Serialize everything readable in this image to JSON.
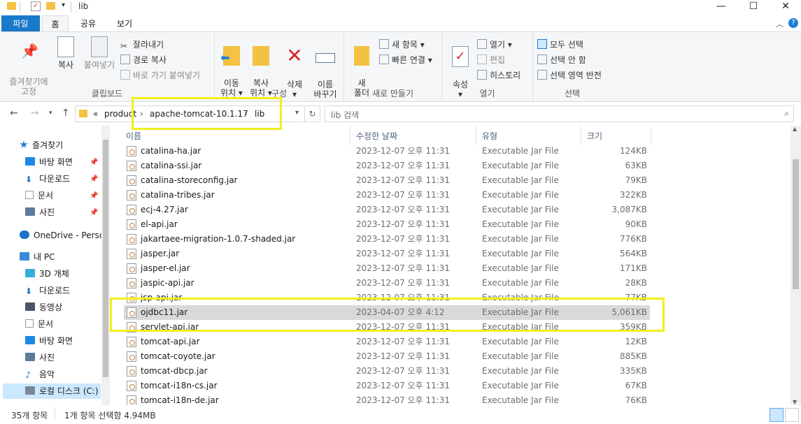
{
  "window": {
    "title": "lib",
    "minimize": "—",
    "maximize": "☐",
    "close": "✕"
  },
  "tabs": {
    "file": "파일",
    "home": "홈",
    "share": "공유",
    "view": "보기"
  },
  "ribbon": {
    "clipboard": {
      "label": "클립보드",
      "pin": "즐겨찾기에\n고정",
      "copy": "복사",
      "paste": "붙여넣기",
      "cut": "잘라내기",
      "copy_path": "경로 복사",
      "paste_shortcut": "바로 가기 붙여넣기"
    },
    "organize": {
      "label": "구성",
      "move_to": "이동\n위치 ▾",
      "copy_to": "복사\n위치 ▾",
      "delete": "삭제\n▾",
      "rename": "이름\n바꾸기"
    },
    "new": {
      "label": "새로 만들기",
      "new_folder": "새\n폴더",
      "new_item": "새 항목 ▾",
      "easy_access": "빠른 연결 ▾"
    },
    "open": {
      "label": "열기",
      "properties": "속성\n▾",
      "open": "열기 ▾",
      "edit": "편집",
      "history": "히스토리"
    },
    "select": {
      "label": "선택",
      "select_all": "모두 선택",
      "select_none": "선택 안 함",
      "invert": "선택 영역 반전"
    }
  },
  "address": {
    "overflow": "«",
    "segments": [
      "product",
      "apache-tomcat-10.1.17",
      "lib"
    ],
    "separator": "›",
    "search_placeholder": "lib 검색"
  },
  "nav": {
    "items": [
      {
        "label": "즐겨찾기",
        "icon": "star-icon",
        "color": "#1e7fd6",
        "pinned": false
      },
      {
        "label": "바탕 화면",
        "icon": "desktop-icon",
        "color": "#1e88e5",
        "pinned": true
      },
      {
        "label": "다운로드",
        "icon": "download-icon",
        "color": "#1e70c8",
        "pinned": true
      },
      {
        "label": "문서",
        "icon": "document-icon",
        "color": "#8a9bb0",
        "pinned": true
      },
      {
        "label": "사진",
        "icon": "pictures-icon",
        "color": "#5c7a9a",
        "pinned": true
      },
      {
        "label": "OneDrive - Person",
        "icon": "cloud-icon",
        "color": "#1a73c9",
        "pinned": false
      },
      {
        "label": "내 PC",
        "icon": "computer-icon",
        "color": "#3b8ad6",
        "pinned": false
      },
      {
        "label": "3D 개체",
        "icon": "cube-icon",
        "color": "#35b0d8",
        "pinned": false
      },
      {
        "label": "다운로드",
        "icon": "download-icon",
        "color": "#1e70c8",
        "pinned": false
      },
      {
        "label": "동영상",
        "icon": "video-icon",
        "color": "#4a5568",
        "pinned": false
      },
      {
        "label": "문서",
        "icon": "document-icon",
        "color": "#8a9bb0",
        "pinned": false
      },
      {
        "label": "바탕 화면",
        "icon": "desktop-icon",
        "color": "#1e88e5",
        "pinned": false
      },
      {
        "label": "사진",
        "icon": "pictures-icon",
        "color": "#5c7a9a",
        "pinned": false
      },
      {
        "label": "음악",
        "icon": "music-icon",
        "color": "#1e7fd6",
        "pinned": false
      },
      {
        "label": "로컬 디스크 (C:)",
        "icon": "drive-icon",
        "color": "#7a8794",
        "pinned": false
      }
    ]
  },
  "columns": {
    "name": "이름",
    "date": "수정한 날짜",
    "type": "유형",
    "size": "크기"
  },
  "files": [
    {
      "name": "catalina-ha.jar",
      "date": "2023-12-07 오후 11:31",
      "type": "Executable Jar File",
      "size": "124KB"
    },
    {
      "name": "catalina-ssi.jar",
      "date": "2023-12-07 오후 11:31",
      "type": "Executable Jar File",
      "size": "63KB"
    },
    {
      "name": "catalina-storeconfig.jar",
      "date": "2023-12-07 오후 11:31",
      "type": "Executable Jar File",
      "size": "79KB"
    },
    {
      "name": "catalina-tribes.jar",
      "date": "2023-12-07 오후 11:31",
      "type": "Executable Jar File",
      "size": "322KB"
    },
    {
      "name": "ecj-4.27.jar",
      "date": "2023-12-07 오후 11:31",
      "type": "Executable Jar File",
      "size": "3,087KB"
    },
    {
      "name": "el-api.jar",
      "date": "2023-12-07 오후 11:31",
      "type": "Executable Jar File",
      "size": "90KB"
    },
    {
      "name": "jakartaee-migration-1.0.7-shaded.jar",
      "date": "2023-12-07 오후 11:31",
      "type": "Executable Jar File",
      "size": "776KB"
    },
    {
      "name": "jasper.jar",
      "date": "2023-12-07 오후 11:31",
      "type": "Executable Jar File",
      "size": "564KB"
    },
    {
      "name": "jasper-el.jar",
      "date": "2023-12-07 오후 11:31",
      "type": "Executable Jar File",
      "size": "171KB"
    },
    {
      "name": "jaspic-api.jar",
      "date": "2023-12-07 오후 11:31",
      "type": "Executable Jar File",
      "size": "28KB"
    },
    {
      "name": "jsp-api.jar",
      "date": "2023-12-07 오후 11:31",
      "type": "Executable Jar File",
      "size": "77KB"
    },
    {
      "name": "ojdbc11.jar",
      "date": "2023-04-07 오후 4:12",
      "type": "Executable Jar File",
      "size": "5,061KB",
      "selected": true
    },
    {
      "name": "servlet-api.jar",
      "date": "2023-12-07 오후 11:31",
      "type": "Executable Jar File",
      "size": "359KB"
    },
    {
      "name": "tomcat-api.jar",
      "date": "2023-12-07 오후 11:31",
      "type": "Executable Jar File",
      "size": "12KB"
    },
    {
      "name": "tomcat-coyote.jar",
      "date": "2023-12-07 오후 11:31",
      "type": "Executable Jar File",
      "size": "885KB"
    },
    {
      "name": "tomcat-dbcp.jar",
      "date": "2023-12-07 오후 11:31",
      "type": "Executable Jar File",
      "size": "335KB"
    },
    {
      "name": "tomcat-i18n-cs.jar",
      "date": "2023-12-07 오후 11:31",
      "type": "Executable Jar File",
      "size": "67KB"
    },
    {
      "name": "tomcat-i18n-de.jar",
      "date": "2023-12-07 오후 11:31",
      "type": "Executable Jar File",
      "size": "76KB"
    }
  ],
  "status": {
    "count": "35개 항목",
    "selection": "1개 항목 선택함 4.94MB"
  },
  "colors": {
    "accent": "#1979ca",
    "selection": "#d9d9d9",
    "highlight": "#f2ef1a",
    "nav_selection": "#cce8ff"
  }
}
